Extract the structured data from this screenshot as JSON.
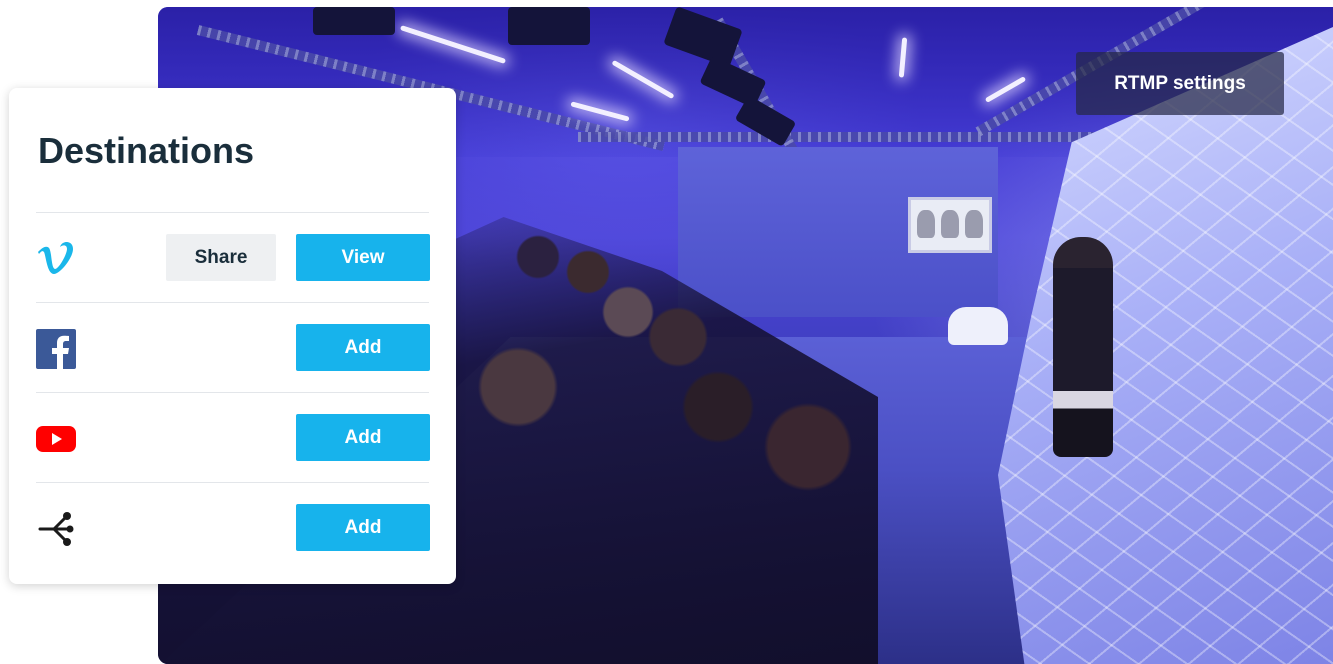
{
  "overlay": {
    "rtmp_label": "RTMP settings"
  },
  "destinations": {
    "title": "Destinations",
    "rows": [
      {
        "service": "Vimeo",
        "icon": "vimeo-icon",
        "secondary_label": "Share",
        "primary_label": "View"
      },
      {
        "service": "Facebook",
        "icon": "facebook-icon",
        "primary_label": "Add"
      },
      {
        "service": "YouTube",
        "icon": "youtube-icon",
        "primary_label": "Add"
      },
      {
        "service": "Custom RTMP",
        "icon": "rtmp-branch-icon",
        "primary_label": "Add"
      }
    ]
  },
  "colors": {
    "primary_button": "#17b3ec",
    "secondary_button": "#eef0f2",
    "title_text": "#1a2e3b",
    "vimeo": "#1ab7ea",
    "facebook": "#3b5998",
    "youtube": "#ff0000"
  }
}
